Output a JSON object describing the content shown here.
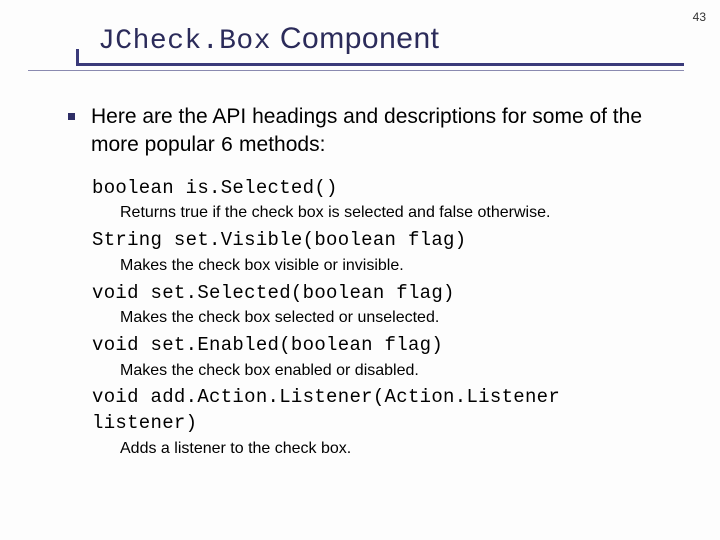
{
  "pageNumber": "43",
  "title": {
    "mono": "JCheck.Box",
    "rest": " Component"
  },
  "lead": {
    "before": "Here are the API headings and descriptions for some of the more popular ",
    "six": "6",
    "after": " methods:"
  },
  "methods": [
    {
      "sig": "boolean is.Selected()",
      "desc": "Returns true if the check box is selected and false otherwise."
    },
    {
      "sig": "String set.Visible(boolean flag)",
      "desc": "Makes the check box visible or invisible."
    },
    {
      "sig": "void set.Selected(boolean flag)",
      "desc": "Makes the check box selected or unselected."
    },
    {
      "sig": "void set.Enabled(boolean flag)",
      "desc": "Makes the check box enabled or disabled."
    },
    {
      "sig": "void add.Action.Listener(Action.Listener listener)",
      "desc": "Adds a listener to the check box."
    }
  ]
}
